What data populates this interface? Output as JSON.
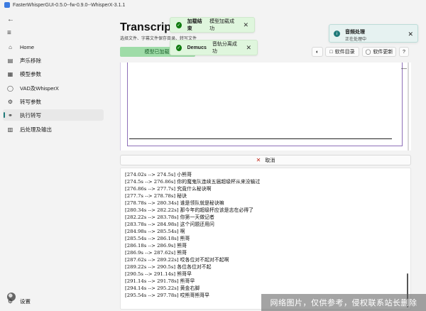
{
  "window": {
    "title": "FasterWhisperGUI-0.5.0--fw-0.9.0--WhisperX-3.1.1"
  },
  "sidebar": {
    "back_icon": "back-arrow-icon",
    "menu_icon": "hamburger-icon",
    "items": [
      {
        "label": "Home",
        "icon": "home-icon"
      },
      {
        "label": "声乐移除",
        "icon": "audio-icon"
      },
      {
        "label": "模型参数",
        "icon": "model-icon"
      },
      {
        "label": "VAD及WhisperX",
        "icon": "vad-icon"
      },
      {
        "label": "转写参数",
        "icon": "gear-icon"
      },
      {
        "label": "执行转写",
        "icon": "headphones-icon",
        "active": true
      },
      {
        "label": "后处理及输出",
        "icon": "output-icon"
      }
    ],
    "settings_label": "设置"
  },
  "main": {
    "title": "Transcripti",
    "subtitle": "选择文件、字幕文件保存目录、转写文件",
    "model_loaded": "模型已加载!",
    "buttons": {
      "theme_icon": "theme-toggle-icon",
      "software_dir": "软件目录",
      "software_update": "软件更新",
      "help": "?"
    },
    "cancel_label": "取消"
  },
  "toasts": [
    {
      "title": "加载结束",
      "message": "模型加载成功"
    },
    {
      "title": "Demucs",
      "message": "音轨分离成功"
    }
  ],
  "info_toast": {
    "title": "音频处理",
    "message": "正在处理中"
  },
  "log": [
    "[274.02s --> 274.5s] 小熊哥",
    "[274.5s --> 276.86s] 你的魔鬼队连续五届超级杯从来没输过",
    "[276.86s --> 277.7s] 究竟什么秘诀啊",
    "[277.7s --> 278.78s] 秘诀",
    "[278.78s --> 280.34s] 谁是领队就是秘诀嘛",
    "[280.34s --> 282.22s] 那今年的超级杯应该是志在必得了",
    "[282.22s --> 283.78s] 你第一天做记者",
    "[283.78s --> 284.98s] 这个问题还用问",
    "[284.98s --> 285.54s] 啊",
    "[285.54s --> 286.18s] 熊哥",
    "[286.18s --> 286.9s] 熊哥",
    "[286.9s --> 287.62s] 熊哥",
    "[287.62s --> 289.22s] 哎各位对不起对不起啊",
    "[289.22s --> 290.5s] 各位各位对不起",
    "[290.5s --> 291.14s] 熊哥早",
    "[291.14s --> 291.78s] 熊哥早",
    "[294.14s --> 295.22s] 黄金右脚",
    "[295.54s --> 297.78s] 哎熊哥熊哥早"
  ],
  "watermark": "网络图片，仅供参考，侵权联系站长删除"
}
